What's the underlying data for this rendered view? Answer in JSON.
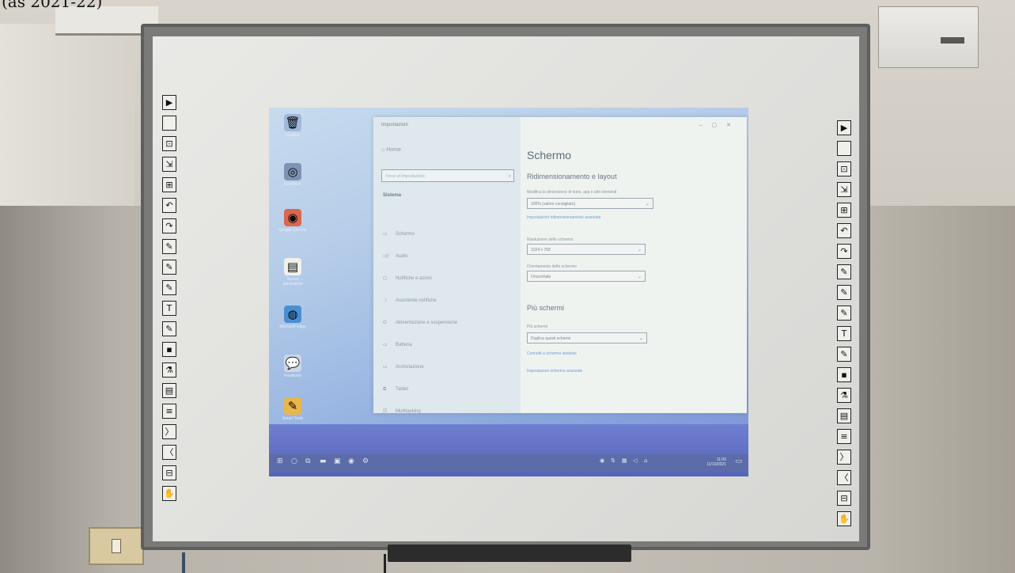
{
  "caption": "(as 2021-22)",
  "board_tools": {
    "left": [
      "▶",
      "",
      "⊡",
      "⇲",
      "⊞",
      "↶",
      "↷",
      "✎",
      "✎",
      "✎",
      "T",
      "✎",
      "▪",
      "⚗",
      "▤",
      "≡",
      "〉",
      "〈",
      "⊟",
      "✋"
    ],
    "right": [
      "▶",
      "",
      "⊡",
      "⇲",
      "⊞",
      "↶",
      "↷",
      "✎",
      "✎",
      "✎",
      "T",
      "✎",
      "▪",
      "⚗",
      "▤",
      "≡",
      "〉",
      "〈",
      "⊟",
      "✋"
    ]
  },
  "desktop_icons": [
    {
      "glyph": "🗑",
      "label": "Cestino",
      "color": "#9fb9d8"
    },
    {
      "glyph": "◎",
      "label": "OneDrive",
      "color": "#7d93b4"
    },
    {
      "glyph": "◉",
      "label": "Google Chrome",
      "color": "#d8684f"
    },
    {
      "glyph": "▤",
      "label": "Nuovo documento",
      "color": "#f1f0ea"
    },
    {
      "glyph": "◍",
      "label": "Microsoft Edge",
      "color": "#4b8fd1"
    },
    {
      "glyph": "💬",
      "label": "Feedback",
      "color": "#ccd6e6"
    },
    {
      "glyph": "✎",
      "label": "Smart Tools",
      "color": "#e9b64a"
    }
  ],
  "settings": {
    "window_title": "Impostazioni",
    "home": "Home",
    "search_placeholder": "Trova un'impostazione",
    "section": "Sistema",
    "nav_items": [
      {
        "icon": "▭",
        "label": "Schermo"
      },
      {
        "icon": "◁)",
        "label": "Audio"
      },
      {
        "icon": "▢",
        "label": "Notifiche e azioni"
      },
      {
        "icon": "☽",
        "label": "Assistente notifiche"
      },
      {
        "icon": "⏻",
        "label": "Alimentazione e sospensione"
      },
      {
        "icon": "▭",
        "label": "Batteria"
      },
      {
        "icon": "▭",
        "label": "Archiviazione"
      },
      {
        "icon": "⧉",
        "label": "Tablet"
      },
      {
        "icon": "☷",
        "label": "Multitasking"
      }
    ],
    "page_title": "Schermo",
    "layout_heading": "Ridimensionamento e layout",
    "scale_label": "Modifica la dimensione di testo, app e altri elementi",
    "scale_value": "100% (valore consigliato)",
    "scale_link": "Impostazioni ridimensionamento avanzate",
    "resolution_label": "Risoluzione dello schermo",
    "resolution_value": "1024 x 768",
    "orientation_label": "Orientamento dello schermo",
    "orientation_value": "Orizzontale",
    "multi_heading": "Più schermi",
    "multi_label": "Più schermi",
    "multi_value": "Duplica questi schermi",
    "multi_link1": "Connetti a schermo wireless",
    "multi_link2": "Impostazioni schermo avanzate"
  },
  "taskbar": {
    "icons": [
      "⊞",
      "○",
      "⧉",
      "▬",
      "▣",
      "◉",
      "⚙"
    ],
    "tray_icons": [
      "◉",
      "⇅",
      "▦",
      "◁",
      "⌂"
    ],
    "time": "11:06",
    "date": "11/10/2021"
  }
}
